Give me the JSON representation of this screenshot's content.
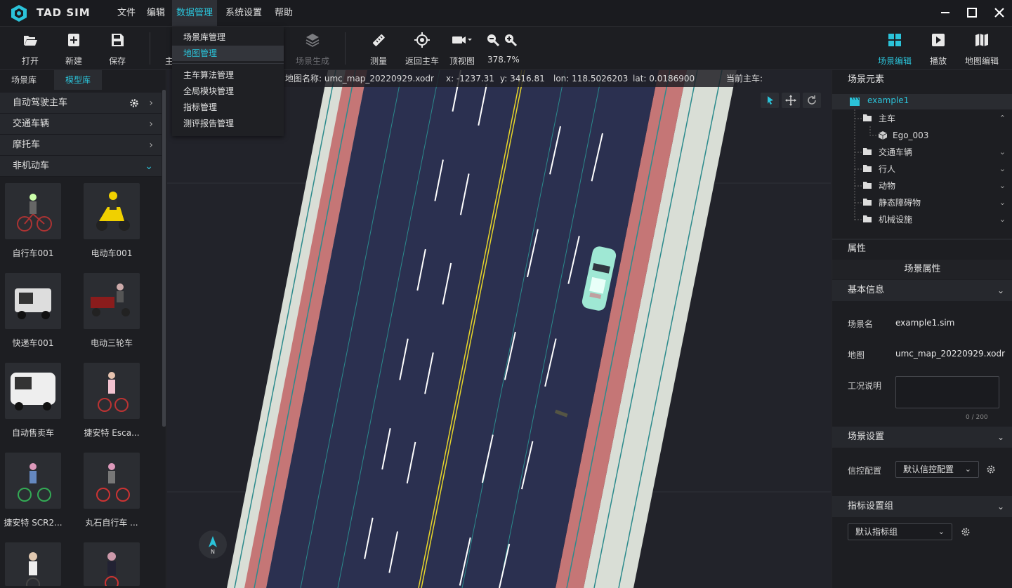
{
  "app": {
    "name": "TAD SIM"
  },
  "menu": [
    {
      "label": "文件"
    },
    {
      "label": "编辑"
    },
    {
      "label": "数据管理"
    },
    {
      "label": "系统设置"
    },
    {
      "label": "帮助"
    }
  ],
  "toolbar": {
    "open": "打开",
    "new": "新建",
    "save": "保存",
    "hidden_partial": "主",
    "scene_gen": "场景生成",
    "measure": "测量",
    "return_ego": "返回主车",
    "top_view": "顶视图",
    "zoom": "378.7%",
    "scene_edit": "场景编辑",
    "play": "播放",
    "map_edit": "地图编辑"
  },
  "dropdown": [
    {
      "label": "场景库管理"
    },
    {
      "label": "地图管理"
    },
    {
      "label": "主车算法管理"
    },
    {
      "label": "全局模块管理"
    },
    {
      "label": "指标管理"
    },
    {
      "label": "测评报告管理"
    }
  ],
  "left": {
    "tabs": [
      "场景库",
      "模型库"
    ],
    "categories": [
      "自动驾驶主车",
      "交通车辆",
      "摩托车",
      "非机动车"
    ],
    "models": [
      "自行车001",
      "电动车001",
      "快递车001",
      "电动三轮车",
      "自动售卖车",
      "捷安特 Esca...",
      "捷安特 SCR2...",
      "丸石自行车 ...",
      "",
      ""
    ]
  },
  "info": {
    "map_name": "地图名称: umc_map_20220929.xodr",
    "x": "x: -1237.31",
    "y": "y: 3416.81",
    "lon": "lon: 118.5026203",
    "lat": "lat: 0.0186900",
    "current_ego": "当前主车:"
  },
  "compass": {
    "label": "N"
  },
  "right": {
    "elements_title": "场景元素",
    "root": "example1",
    "tree": [
      {
        "label": "主车",
        "chev": "⌃"
      },
      {
        "label": "Ego_003",
        "chev": ""
      },
      {
        "label": "交通车辆",
        "chev": "⌄"
      },
      {
        "label": "行人",
        "chev": "⌄"
      },
      {
        "label": "动物",
        "chev": "⌄"
      },
      {
        "label": "静态障碍物",
        "chev": "⌄"
      },
      {
        "label": "机械设施",
        "chev": "⌄"
      }
    ],
    "props_title": "属性",
    "scene_props": "场景属性",
    "basic_info": "基本信息",
    "scene_name_label": "场景名",
    "scene_name": "example1.sim",
    "map_label": "地图",
    "map_value": "umc_map_20220929.xodr",
    "condition_label": "工况说明",
    "char_count": "0 / 200",
    "scene_settings": "场景设置",
    "signal_label": "信控配置",
    "signal_value": "默认信控配置",
    "metric_group_title": "指标设置组",
    "metric_group_value": "默认指标组"
  },
  "colors": {
    "accent": "#2bc3d9",
    "road": "#2a3050",
    "bike_lane": "#c57575",
    "sidewalk": "#d8ddd5",
    "ego_car": "#9fe8d4"
  }
}
